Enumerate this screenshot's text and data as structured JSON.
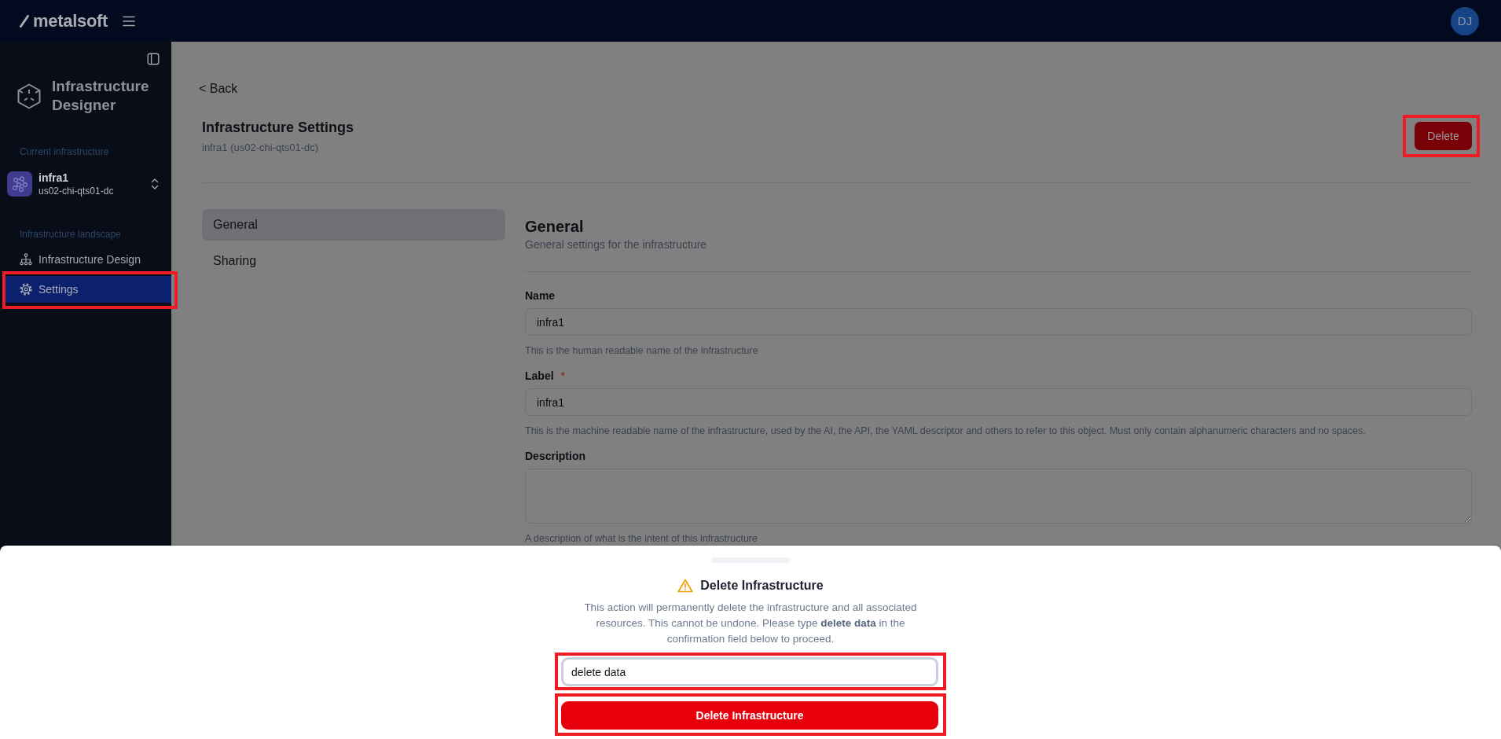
{
  "top_bar": {
    "logo": "metalsoft",
    "avatar": "DJ"
  },
  "sidebar": {
    "title": "Infrastructure Designer",
    "current_heading": "Current infrastructure",
    "current_infrastructure": {
      "name": "infra1",
      "location": "us02-chi-qts01-dc"
    },
    "nav_heading": "Infrastructure landscape",
    "items": [
      {
        "label": "Infrastructure Design",
        "kind": "design",
        "selected": false,
        "highlighted": false
      },
      {
        "label": "Settings",
        "kind": "settings",
        "selected": true,
        "highlighted": true
      }
    ]
  },
  "page": {
    "back_link": "< Back",
    "title": "Infrastructure Settings",
    "subtitle": "infra1 (us02-chi-qts01-dc)",
    "delete_button": {
      "label": "Delete",
      "highlighted": true
    }
  },
  "settings_nav": [
    {
      "label": "General",
      "selected": true
    },
    {
      "label": "Sharing",
      "selected": false
    }
  ],
  "section": {
    "title": "General",
    "subtitle": "General settings for the infrastructure",
    "fields": [
      {
        "kind": "text",
        "label": "Name",
        "value": "infra1",
        "help": "This is the human readable name of the infrastructure"
      },
      {
        "kind": "text",
        "label": "Label",
        "required_mark": "*",
        "value": "infra1",
        "help": "This is the machine readable name of the infrastructure, used by the AI, the API, the YAML descriptor and others to refer to this object. Must only contain alphanumeric characters and no spaces."
      },
      {
        "kind": "textarea",
        "label": "Description",
        "help": "A description of what is the intent of this infrastructure"
      }
    ]
  },
  "dialog": {
    "title": "Delete Infrastructure",
    "message": "This action will permanently delete the infrastructure and all associated resources. This cannot be undone. Please type **delete data** in the confirmation field below to proceed.",
    "input": {
      "value": "delete data",
      "focused": true,
      "highlighted": true
    },
    "confirm_button": {
      "label": "Delete Infrastructure",
      "highlighted": true
    }
  }
}
